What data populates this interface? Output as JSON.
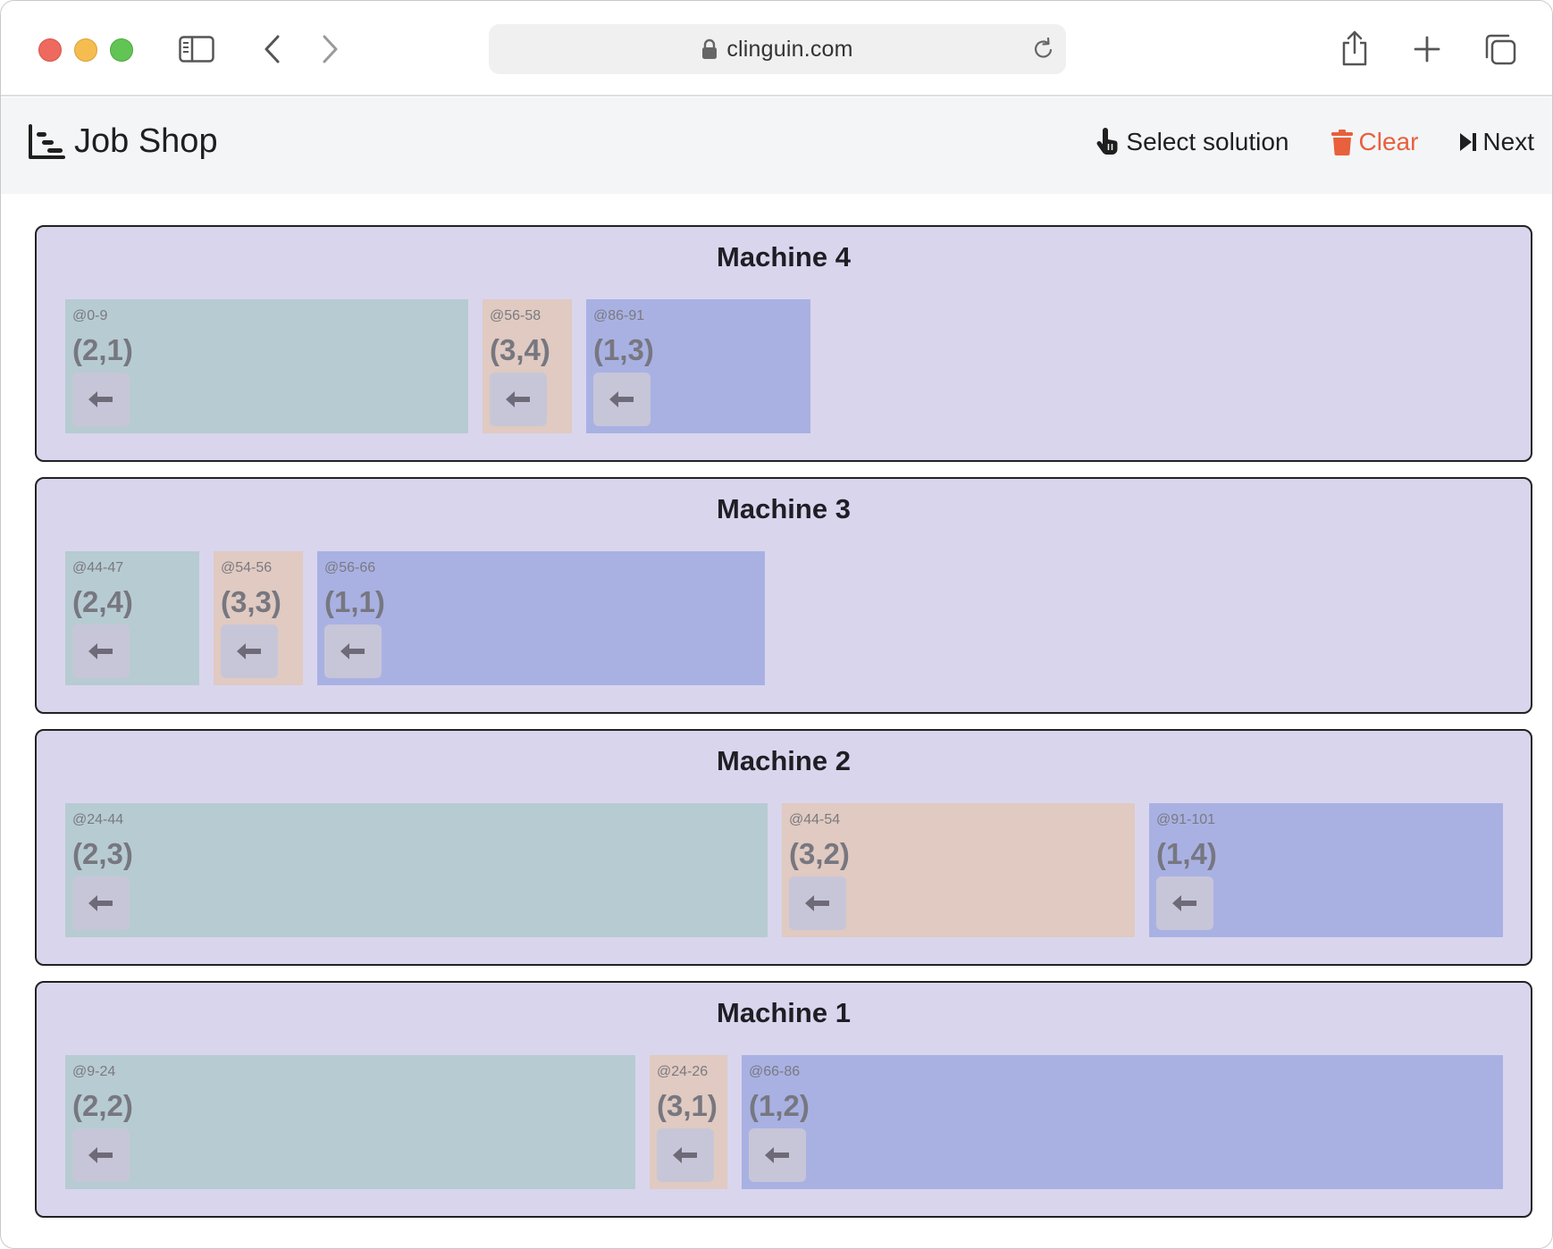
{
  "browser": {
    "url": "clinguin.com"
  },
  "app": {
    "title": "Job Shop",
    "actions": {
      "select_solution": "Select solution",
      "clear": "Clear",
      "next": "Next"
    },
    "colors": {
      "machine_bg": "#d9d5ed",
      "job1": "#a9b1e3",
      "job2": "#b7cbd2",
      "job3": "#e0cac1",
      "clear": "#e8603c"
    }
  },
  "machines": [
    {
      "title": "Machine 4",
      "tasks": [
        {
          "job": 2,
          "time": "@0-9",
          "label": "(2,1)"
        },
        {
          "job": 3,
          "time": "@56-58",
          "label": "(3,4)"
        },
        {
          "job": 1,
          "time": "@86-91",
          "label": "(1,3)"
        }
      ]
    },
    {
      "title": "Machine 3",
      "tasks": [
        {
          "job": 2,
          "time": "@44-47",
          "label": "(2,4)"
        },
        {
          "job": 3,
          "time": "@54-56",
          "label": "(3,3)"
        },
        {
          "job": 1,
          "time": "@56-66",
          "label": "(1,1)"
        }
      ]
    },
    {
      "title": "Machine 2",
      "tasks": [
        {
          "job": 2,
          "time": "@24-44",
          "label": "(2,3)"
        },
        {
          "job": 3,
          "time": "@44-54",
          "label": "(3,2)"
        },
        {
          "job": 1,
          "time": "@91-101",
          "label": "(1,4)"
        }
      ]
    },
    {
      "title": "Machine 1",
      "tasks": [
        {
          "job": 2,
          "time": "@9-24",
          "label": "(2,2)"
        },
        {
          "job": 3,
          "time": "@24-26",
          "label": "(3,1)"
        },
        {
          "job": 1,
          "time": "@66-86",
          "label": "(1,2)"
        }
      ]
    }
  ]
}
